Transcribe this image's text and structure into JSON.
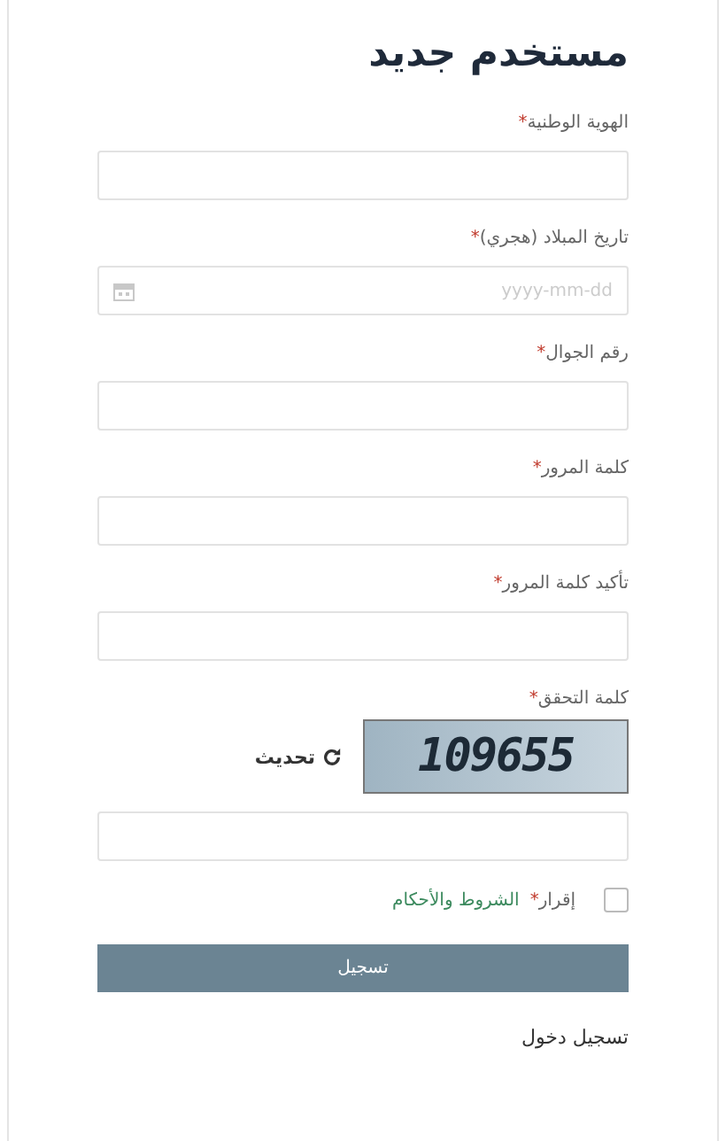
{
  "title": "مستخدم جديد",
  "fields": [
    {
      "kind": "text",
      "label": "الهوية الوطنية",
      "mark": "*"
    },
    {
      "kind": "date",
      "label": "تاريخ المبلاد (هجري)",
      "mark": "*",
      "placeholder": "yyyy-mm-dd"
    },
    {
      "kind": "text",
      "label": "رقم الجوال",
      "mark": "*"
    },
    {
      "kind": "text",
      "label": "كلمة المرور",
      "mark": "*"
    },
    {
      "kind": "text",
      "label": "تأكيد كلمة المرور",
      "mark": "*"
    }
  ],
  "captcha": {
    "label": "كلمة التحقق",
    "mark": "*",
    "code": "109655",
    "refresh": "تحديث"
  },
  "consent": {
    "checked": false,
    "label": "إقرار",
    "mark": "*",
    "link": "الشروط والأحكام"
  },
  "submit": "تسجيل",
  "login_link": "تسجيل دخول"
}
